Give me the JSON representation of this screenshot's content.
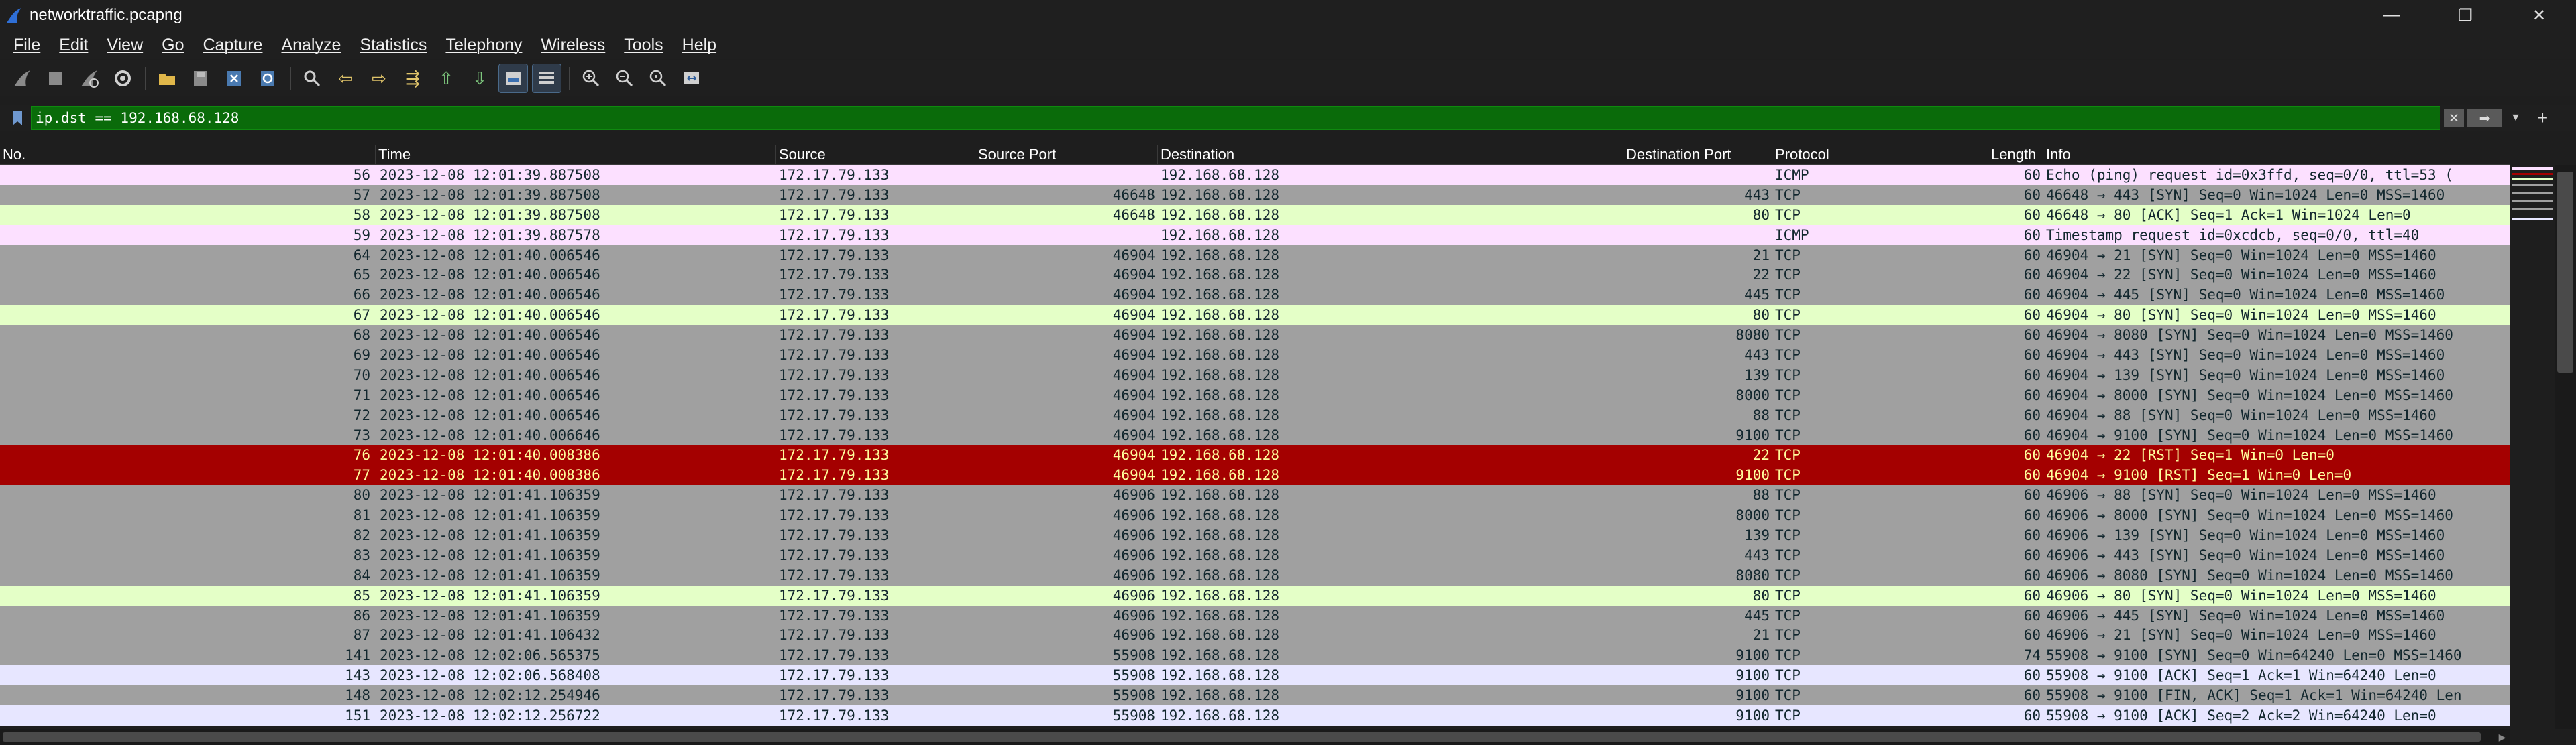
{
  "window": {
    "title": "networktraffic.pcapng",
    "controls": [
      "—",
      "❐",
      "✕"
    ]
  },
  "menu": [
    "File",
    "Edit",
    "View",
    "Go",
    "Capture",
    "Analyze",
    "Statistics",
    "Telephony",
    "Wireless",
    "Tools",
    "Help"
  ],
  "filter": {
    "value": "ip.dst == 192.168.68.128",
    "apply_label": "➡",
    "clear_label": "✕",
    "add_label": "+"
  },
  "columns": [
    "No.",
    "Time",
    "Source",
    "Source Port",
    "Destination",
    "Destination Port",
    "Protocol",
    "Length",
    "Info"
  ],
  "packets": [
    {
      "no": "56",
      "time": "2023-12-08 12:01:39.887508",
      "src": "172.17.79.133",
      "sport": "",
      "dst": "192.168.68.128",
      "dport": "",
      "proto": "ICMP",
      "len": "60",
      "info": "Echo (ping) request  id=0x3ffd, seq=0/0, ttl=53 (",
      "style": "icmp"
    },
    {
      "no": "57",
      "time": "2023-12-08 12:01:39.887508",
      "src": "172.17.79.133",
      "sport": "46648",
      "dst": "192.168.68.128",
      "dport": "443",
      "proto": "TCP",
      "len": "60",
      "info": "46648 → 443 [SYN] Seq=0 Win=1024 Len=0 MSS=1460",
      "style": "gray"
    },
    {
      "no": "58",
      "time": "2023-12-08 12:01:39.887508",
      "src": "172.17.79.133",
      "sport": "46648",
      "dst": "192.168.68.128",
      "dport": "80",
      "proto": "TCP",
      "len": "60",
      "info": "46648 → 80 [ACK] Seq=1 Ack=1 Win=1024 Len=0",
      "style": "green"
    },
    {
      "no": "59",
      "time": "2023-12-08 12:01:39.887578",
      "src": "172.17.79.133",
      "sport": "",
      "dst": "192.168.68.128",
      "dport": "",
      "proto": "ICMP",
      "len": "60",
      "info": "Timestamp request    id=0xcdcb, seq=0/0, ttl=40",
      "style": "icmp"
    },
    {
      "no": "64",
      "time": "2023-12-08 12:01:40.006546",
      "src": "172.17.79.133",
      "sport": "46904",
      "dst": "192.168.68.128",
      "dport": "21",
      "proto": "TCP",
      "len": "60",
      "info": "46904 → 21 [SYN] Seq=0 Win=1024 Len=0 MSS=1460",
      "style": "gray"
    },
    {
      "no": "65",
      "time": "2023-12-08 12:01:40.006546",
      "src": "172.17.79.133",
      "sport": "46904",
      "dst": "192.168.68.128",
      "dport": "22",
      "proto": "TCP",
      "len": "60",
      "info": "46904 → 22 [SYN] Seq=0 Win=1024 Len=0 MSS=1460",
      "style": "gray"
    },
    {
      "no": "66",
      "time": "2023-12-08 12:01:40.006546",
      "src": "172.17.79.133",
      "sport": "46904",
      "dst": "192.168.68.128",
      "dport": "445",
      "proto": "TCP",
      "len": "60",
      "info": "46904 → 445 [SYN] Seq=0 Win=1024 Len=0 MSS=1460",
      "style": "gray"
    },
    {
      "no": "67",
      "time": "2023-12-08 12:01:40.006546",
      "src": "172.17.79.133",
      "sport": "46904",
      "dst": "192.168.68.128",
      "dport": "80",
      "proto": "TCP",
      "len": "60",
      "info": "46904 → 80 [SYN] Seq=0 Win=1024 Len=0 MSS=1460",
      "style": "green"
    },
    {
      "no": "68",
      "time": "2023-12-08 12:01:40.006546",
      "src": "172.17.79.133",
      "sport": "46904",
      "dst": "192.168.68.128",
      "dport": "8080",
      "proto": "TCP",
      "len": "60",
      "info": "46904 → 8080 [SYN] Seq=0 Win=1024 Len=0 MSS=1460",
      "style": "gray"
    },
    {
      "no": "69",
      "time": "2023-12-08 12:01:40.006546",
      "src": "172.17.79.133",
      "sport": "46904",
      "dst": "192.168.68.128",
      "dport": "443",
      "proto": "TCP",
      "len": "60",
      "info": "46904 → 443 [SYN] Seq=0 Win=1024 Len=0 MSS=1460",
      "style": "gray"
    },
    {
      "no": "70",
      "time": "2023-12-08 12:01:40.006546",
      "src": "172.17.79.133",
      "sport": "46904",
      "dst": "192.168.68.128",
      "dport": "139",
      "proto": "TCP",
      "len": "60",
      "info": "46904 → 139 [SYN] Seq=0 Win=1024 Len=0 MSS=1460",
      "style": "gray"
    },
    {
      "no": "71",
      "time": "2023-12-08 12:01:40.006546",
      "src": "172.17.79.133",
      "sport": "46904",
      "dst": "192.168.68.128",
      "dport": "8000",
      "proto": "TCP",
      "len": "60",
      "info": "46904 → 8000 [SYN] Seq=0 Win=1024 Len=0 MSS=1460",
      "style": "gray"
    },
    {
      "no": "72",
      "time": "2023-12-08 12:01:40.006546",
      "src": "172.17.79.133",
      "sport": "46904",
      "dst": "192.168.68.128",
      "dport": "88",
      "proto": "TCP",
      "len": "60",
      "info": "46904 → 88 [SYN] Seq=0 Win=1024 Len=0 MSS=1460",
      "style": "gray"
    },
    {
      "no": "73",
      "time": "2023-12-08 12:01:40.006646",
      "src": "172.17.79.133",
      "sport": "46904",
      "dst": "192.168.68.128",
      "dport": "9100",
      "proto": "TCP",
      "len": "60",
      "info": "46904 → 9100 [SYN] Seq=0 Win=1024 Len=0 MSS=1460",
      "style": "gray"
    },
    {
      "no": "76",
      "time": "2023-12-08 12:01:40.008386",
      "src": "172.17.79.133",
      "sport": "46904",
      "dst": "192.168.68.128",
      "dport": "22",
      "proto": "TCP",
      "len": "60",
      "info": "46904 → 22 [RST] Seq=1 Win=0 Len=0",
      "style": "rst"
    },
    {
      "no": "77",
      "time": "2023-12-08 12:01:40.008386",
      "src": "172.17.79.133",
      "sport": "46904",
      "dst": "192.168.68.128",
      "dport": "9100",
      "proto": "TCP",
      "len": "60",
      "info": "46904 → 9100 [RST] Seq=1 Win=0 Len=0",
      "style": "rst"
    },
    {
      "no": "80",
      "time": "2023-12-08 12:01:41.106359",
      "src": "172.17.79.133",
      "sport": "46906",
      "dst": "192.168.68.128",
      "dport": "88",
      "proto": "TCP",
      "len": "60",
      "info": "46906 → 88 [SYN] Seq=0 Win=1024 Len=0 MSS=1460",
      "style": "gray"
    },
    {
      "no": "81",
      "time": "2023-12-08 12:01:41.106359",
      "src": "172.17.79.133",
      "sport": "46906",
      "dst": "192.168.68.128",
      "dport": "8000",
      "proto": "TCP",
      "len": "60",
      "info": "46906 → 8000 [SYN] Seq=0 Win=1024 Len=0 MSS=1460",
      "style": "gray"
    },
    {
      "no": "82",
      "time": "2023-12-08 12:01:41.106359",
      "src": "172.17.79.133",
      "sport": "46906",
      "dst": "192.168.68.128",
      "dport": "139",
      "proto": "TCP",
      "len": "60",
      "info": "46906 → 139 [SYN] Seq=0 Win=1024 Len=0 MSS=1460",
      "style": "gray"
    },
    {
      "no": "83",
      "time": "2023-12-08 12:01:41.106359",
      "src": "172.17.79.133",
      "sport": "46906",
      "dst": "192.168.68.128",
      "dport": "443",
      "proto": "TCP",
      "len": "60",
      "info": "46906 → 443 [SYN] Seq=0 Win=1024 Len=0 MSS=1460",
      "style": "gray"
    },
    {
      "no": "84",
      "time": "2023-12-08 12:01:41.106359",
      "src": "172.17.79.133",
      "sport": "46906",
      "dst": "192.168.68.128",
      "dport": "8080",
      "proto": "TCP",
      "len": "60",
      "info": "46906 → 8080 [SYN] Seq=0 Win=1024 Len=0 MSS=1460",
      "style": "gray"
    },
    {
      "no": "85",
      "time": "2023-12-08 12:01:41.106359",
      "src": "172.17.79.133",
      "sport": "46906",
      "dst": "192.168.68.128",
      "dport": "80",
      "proto": "TCP",
      "len": "60",
      "info": "46906 → 80 [SYN] Seq=0 Win=1024 Len=0 MSS=1460",
      "style": "green"
    },
    {
      "no": "86",
      "time": "2023-12-08 12:01:41.106359",
      "src": "172.17.79.133",
      "sport": "46906",
      "dst": "192.168.68.128",
      "dport": "445",
      "proto": "TCP",
      "len": "60",
      "info": "46906 → 445 [SYN] Seq=0 Win=1024 Len=0 MSS=1460",
      "style": "gray"
    },
    {
      "no": "87",
      "time": "2023-12-08 12:01:41.106432",
      "src": "172.17.79.133",
      "sport": "46906",
      "dst": "192.168.68.128",
      "dport": "21",
      "proto": "TCP",
      "len": "60",
      "info": "46906 → 21 [SYN] Seq=0 Win=1024 Len=0 MSS=1460",
      "style": "gray"
    },
    {
      "no": "141",
      "time": "2023-12-08 12:02:06.565375",
      "src": "172.17.79.133",
      "sport": "55908",
      "dst": "192.168.68.128",
      "dport": "9100",
      "proto": "TCP",
      "len": "74",
      "info": "55908 → 9100 [SYN] Seq=0 Win=64240 Len=0 MSS=1460",
      "style": "gray"
    },
    {
      "no": "143",
      "time": "2023-12-08 12:02:06.568408",
      "src": "172.17.79.133",
      "sport": "55908",
      "dst": "192.168.68.128",
      "dport": "9100",
      "proto": "TCP",
      "len": "60",
      "info": "55908 → 9100 [ACK] Seq=1 Ack=1 Win=64240 Len=0",
      "style": "lav"
    },
    {
      "no": "148",
      "time": "2023-12-08 12:02:12.254946",
      "src": "172.17.79.133",
      "sport": "55908",
      "dst": "192.168.68.128",
      "dport": "9100",
      "proto": "TCP",
      "len": "60",
      "info": "55908 → 9100 [FIN, ACK] Seq=1 Ack=1 Win=64240 Len",
      "style": "gray"
    },
    {
      "no": "151",
      "time": "2023-12-08 12:02:12.256722",
      "src": "172.17.79.133",
      "sport": "55908",
      "dst": "192.168.68.128",
      "dport": "9100",
      "proto": "TCP",
      "len": "60",
      "info": "55908 → 9100 [ACK] Seq=2 Ack=2 Win=64240 Len=0",
      "style": "lav"
    }
  ],
  "colors": {
    "icmp": "#fce0ff",
    "gray": "#a0a0a0",
    "green": "#e4ffc7",
    "rst": "#a40000",
    "lav": "#e7e6ff",
    "filter_valid": "#0a6b0a"
  }
}
